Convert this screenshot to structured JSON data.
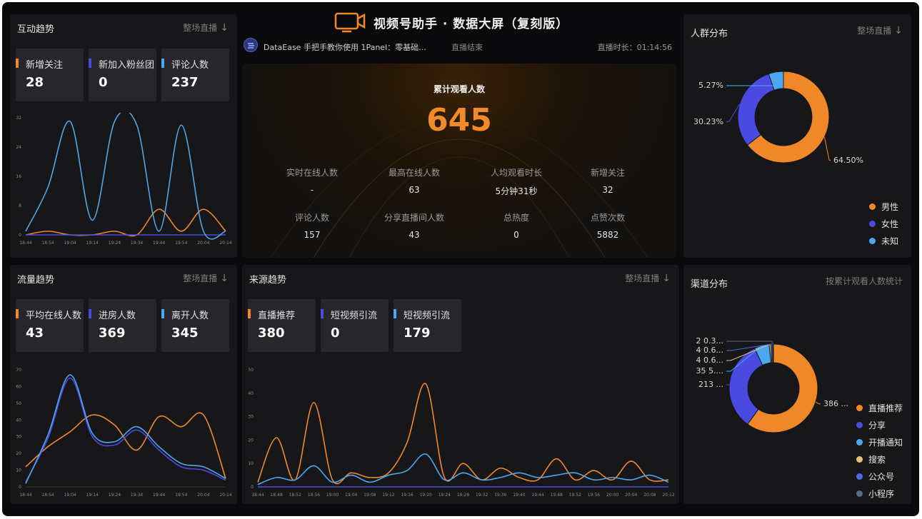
{
  "header": {
    "title": "视频号助手 · 数据大屏（复刻版）",
    "live_title": "DataEase 手把手教你使用 1Panel：零基础...",
    "live_status": "直播结束",
    "duration_label": "直播时长：",
    "duration_value": "01:14:56"
  },
  "overview": {
    "title": "累计观看人数",
    "total": "645",
    "stats": [
      {
        "label": "实时在线人数",
        "value": "-"
      },
      {
        "label": "最高在线人数",
        "value": "63"
      },
      {
        "label": "人均观看时长",
        "value": "5分钟31秒"
      },
      {
        "label": "新增关注",
        "value": "32"
      },
      {
        "label": "评论人数",
        "value": "157"
      },
      {
        "label": "分享直播间人数",
        "value": "43"
      },
      {
        "label": "总热度",
        "value": "0"
      },
      {
        "label": "点赞次数",
        "value": "5882"
      }
    ]
  },
  "interaction": {
    "title": "互动趋势",
    "filter": "整场直播",
    "cards": [
      {
        "label": "新增关注",
        "value": "28",
        "color": "#f0882a"
      },
      {
        "label": "新加入粉丝团",
        "value": "0",
        "color": "#4a4ae0"
      },
      {
        "label": "评论人数",
        "value": "237",
        "color": "#4aa8f0"
      }
    ]
  },
  "traffic": {
    "title": "流量趋势",
    "filter": "整场直播",
    "cards": [
      {
        "label": "平均在线人数",
        "value": "43",
        "color": "#f0882a"
      },
      {
        "label": "进房人数",
        "value": "369",
        "color": "#4a4ae0"
      },
      {
        "label": "离开人数",
        "value": "345",
        "color": "#4aa8f0"
      }
    ]
  },
  "source": {
    "title": "来源趋势",
    "filter": "整场直播",
    "cards": [
      {
        "label": "直播推荐",
        "value": "380",
        "color": "#f0882a"
      },
      {
        "label": "短视频引流",
        "value": "0",
        "color": "#4a4ae0"
      },
      {
        "label": "短视频引流",
        "value": "179",
        "color": "#4aa8f0"
      }
    ]
  },
  "crowd": {
    "title": "人群分布",
    "filter": "整场直播",
    "legend": [
      {
        "label": "男性",
        "color": "#f0882a"
      },
      {
        "label": "女性",
        "color": "#4a4ae0"
      },
      {
        "label": "未知",
        "color": "#4aa8f0"
      }
    ]
  },
  "channel": {
    "title": "渠道分布",
    "filter": "按累计观看人数统计",
    "legend": [
      {
        "label": "直播推荐",
        "color": "#f0882a"
      },
      {
        "label": "分享",
        "color": "#4a4ae0"
      },
      {
        "label": "开播通知",
        "color": "#4aa8f0"
      },
      {
        "label": "搜索",
        "color": "#e8c07a"
      },
      {
        "label": "公众号",
        "color": "#4a6ee0"
      },
      {
        "label": "小程序",
        "color": "#5a6a80"
      }
    ]
  },
  "chart_data": [
    {
      "id": "interaction",
      "type": "line",
      "x": [
        "18:44",
        "18:54",
        "19:04",
        "19:14",
        "19:24",
        "19:34",
        "19:44",
        "19:54",
        "20:04",
        "20:14"
      ],
      "ylim": [
        0,
        32
      ],
      "yticks": [
        0,
        8,
        16,
        24,
        32
      ],
      "series": [
        {
          "color": "#f0882a",
          "values": [
            0,
            1,
            0,
            0,
            1,
            0,
            7,
            1,
            7,
            1
          ]
        },
        {
          "color": "#4a4ae0",
          "values": [
            0,
            0,
            0,
            0,
            0,
            0,
            0,
            0,
            0,
            0
          ]
        },
        {
          "color": "#4aa8f0",
          "values": [
            1,
            13,
            31,
            4,
            31,
            30,
            1,
            30,
            1,
            1
          ]
        }
      ]
    },
    {
      "id": "traffic",
      "type": "line",
      "x": [
        "18:44",
        "18:54",
        "19:04",
        "19:14",
        "19:24",
        "19:34",
        "19:44",
        "19:54",
        "20:04",
        "20:14"
      ],
      "ylim": [
        0,
        70
      ],
      "yticks": [
        0,
        10,
        20,
        30,
        40,
        50,
        60,
        70
      ],
      "series": [
        {
          "color": "#f0882a",
          "values": [
            12,
            24,
            33,
            43,
            37,
            22,
            42,
            36,
            43,
            5
          ]
        },
        {
          "color": "#4a4ae0",
          "values": [
            3,
            29,
            65,
            30,
            25,
            34,
            22,
            12,
            10,
            4
          ]
        },
        {
          "color": "#4aa8f0",
          "values": [
            2,
            31,
            67,
            32,
            27,
            36,
            24,
            14,
            12,
            5
          ]
        }
      ]
    },
    {
      "id": "source",
      "type": "line",
      "x": [
        "18:44",
        "18:48",
        "18:52",
        "18:56",
        "19:00",
        "19:04",
        "19:08",
        "19:12",
        "19:16",
        "19:20",
        "19:24",
        "19:28",
        "19:32",
        "19:36",
        "19:40",
        "19:44",
        "19:48",
        "19:52",
        "19:56",
        "20:00",
        "20:04",
        "20:08",
        "20:12"
      ],
      "ylim": [
        0,
        50
      ],
      "yticks": [
        0,
        10,
        20,
        30,
        40,
        50
      ],
      "series": [
        {
          "color": "#f0882a",
          "values": [
            2,
            21,
            3,
            36,
            3,
            6,
            4,
            6,
            19,
            44,
            4,
            10,
            3,
            8,
            4,
            3,
            12,
            3,
            7,
            3,
            11,
            3,
            3
          ]
        },
        {
          "color": "#4a4ae0",
          "values": [
            0,
            0,
            0,
            0,
            0,
            0,
            0,
            0,
            0,
            0,
            0,
            0,
            0,
            0,
            0,
            0,
            0,
            0,
            0,
            0,
            0,
            0,
            0
          ]
        },
        {
          "color": "#4aa8f0",
          "values": [
            1,
            4,
            3,
            9,
            2,
            5,
            2,
            5,
            7,
            14,
            3,
            6,
            3,
            4,
            6,
            4,
            5,
            6,
            3,
            4,
            3,
            5,
            2
          ]
        }
      ]
    },
    {
      "id": "crowd",
      "type": "pie",
      "labels": [
        "男性",
        "女性",
        "未知"
      ],
      "values": [
        64.5,
        30.23,
        5.27
      ],
      "data_labels": [
        "64.50%",
        "30.23%",
        "5.27%"
      ],
      "colors": [
        "#f0882a",
        "#4a4ae0",
        "#4aa8f0"
      ]
    },
    {
      "id": "channel",
      "type": "pie",
      "labels": [
        "直播推荐",
        "分享",
        "开播通知",
        "搜索",
        "公众号",
        "小程序"
      ],
      "values": [
        386,
        213,
        35,
        4,
        4,
        2
      ],
      "data_labels": [
        "386 ...",
        "213 ...",
        "35 5....",
        "4 0.6...",
        "4 0.6...",
        "2 0.3..."
      ],
      "colors": [
        "#f0882a",
        "#4a4ae0",
        "#4aa8f0",
        "#e8c07a",
        "#4a6ee0",
        "#5a6a80"
      ]
    }
  ]
}
